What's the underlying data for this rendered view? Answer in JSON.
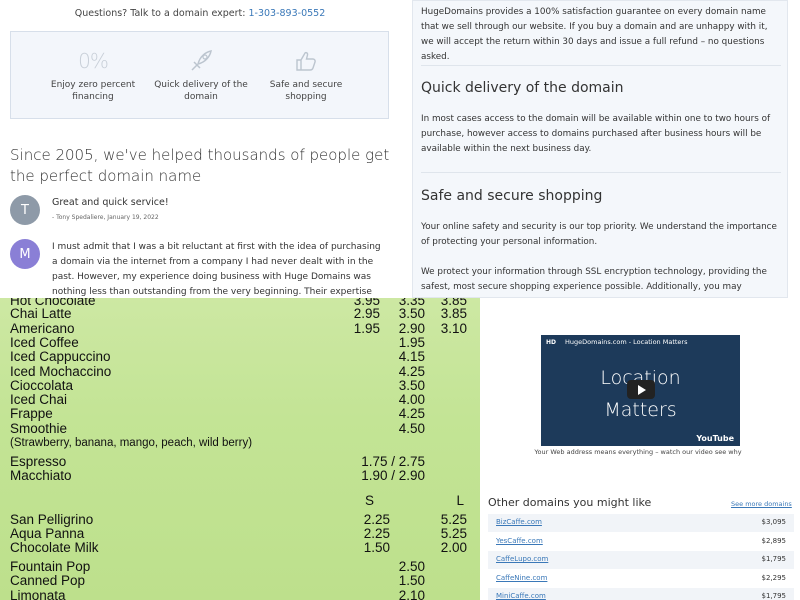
{
  "header": {
    "questions_text": "Questions? Talk to a domain expert:",
    "phone": "1-303-893-0552"
  },
  "features": [
    {
      "icon": "percent-icon",
      "icon_text": "0%",
      "label": "Enjoy zero percent financing"
    },
    {
      "icon": "rocket-icon",
      "label": "Quick delivery of the domain"
    },
    {
      "icon": "thumbs-up-icon",
      "label": "Safe and secure shopping"
    }
  ],
  "since_heading": "Since 2005, we've helped thousands of people get the perfect domain name",
  "reviews": [
    {
      "initial": "T",
      "avatar_color": "#8e9aa8",
      "title": "Great and quick service!",
      "meta": "- Tony Spedaliere, January 19, 2022"
    },
    {
      "initial": "M",
      "avatar_color": "#8a7fd6",
      "body": "I must admit that I was a bit reluctant at first with the idea of purchasing a domain via the internet from a company I had never dealt with in the past. However, my experience doing business with Huge Domains was nothing less than outstanding from the very beginning. Their expertise and method of doing"
    }
  ],
  "right_panel": {
    "guarantee_text": "HugeDomains provides a 100% satisfaction guarantee on every domain name that we sell through our website. If you buy a domain and are unhappy with it, we will accept the return within 30 days and issue a full refund – no questions asked.",
    "quick_heading": "Quick delivery of the domain",
    "quick_text": "In most cases access to the domain will be available within one to two hours of purchase, however access to domains purchased after business hours will be available within the next business day.",
    "safe_heading": "Safe and secure shopping",
    "safe_text": "Your online safety and security is our top priority. We understand the importance of protecting your personal information.",
    "protect_text": "We protect your information through SSL encryption technology, providing the safest, most secure shopping experience possible. Additionally, you may checkout with PayPal"
  },
  "menu": {
    "items": [
      {
        "name": "Hot Chocolate",
        "s": "3.95",
        "m": "3.35",
        "l": "3.85"
      },
      {
        "name": "Chai Latte",
        "s": "2.95",
        "m": "3.50",
        "l": "3.85"
      },
      {
        "name": "Americano",
        "s": "1.95",
        "m": "2.90",
        "l": "3.10"
      },
      {
        "name": "Iced Coffee",
        "m": "1.95"
      },
      {
        "name": "Iced Cappuccino",
        "m": "4.15"
      },
      {
        "name": "Iced Mochaccino",
        "m": "4.25"
      },
      {
        "name": "Cioccolata",
        "m": "3.50"
      },
      {
        "name": "Iced Chai",
        "m": "4.00"
      },
      {
        "name": "Frappe",
        "m": "4.25"
      },
      {
        "name": "Smoothie",
        "m": "4.50"
      },
      {
        "name": "(Strawberry, banana, mango, peach, wild berry)"
      },
      {
        "name": "Espresso",
        "m": "1.75 / 2.75"
      },
      {
        "name": "Macchiato",
        "m": "1.90 / 2.90"
      },
      {
        "name": "San Pelligrino",
        "s": "2.25",
        "l": "5.25"
      },
      {
        "name": "Aqua Panna",
        "s": "2.25",
        "l": "5.25"
      },
      {
        "name": "Chocolate Milk",
        "s": "1.50",
        "l": "2.00"
      },
      {
        "name": "Fountain Pop",
        "m": "2.50"
      },
      {
        "name": "Canned Pop",
        "m": "1.50"
      },
      {
        "name": "Limonata",
        "m": "2.10"
      }
    ],
    "header_s": "S",
    "header_l": "L"
  },
  "video": {
    "hd": "HD",
    "title": "HugeDomains.com - Location Matters",
    "line1": "Location",
    "line2": "Matters",
    "youtube": "YouTube",
    "caption": "Your Web address means everything – watch our video see why"
  },
  "other_domains": {
    "title": "Other domains you might like",
    "see_more": "See more domains",
    "rows": [
      {
        "name": "BizCaffe.com",
        "price": "$3,095"
      },
      {
        "name": "YesCaffe.com",
        "price": "$2,895"
      },
      {
        "name": "CaffeLupo.com",
        "price": "$1,795"
      },
      {
        "name": "CaffeNine.com",
        "price": "$2,295"
      },
      {
        "name": "MiniCaffe.com",
        "price": "$1,795"
      }
    ]
  }
}
